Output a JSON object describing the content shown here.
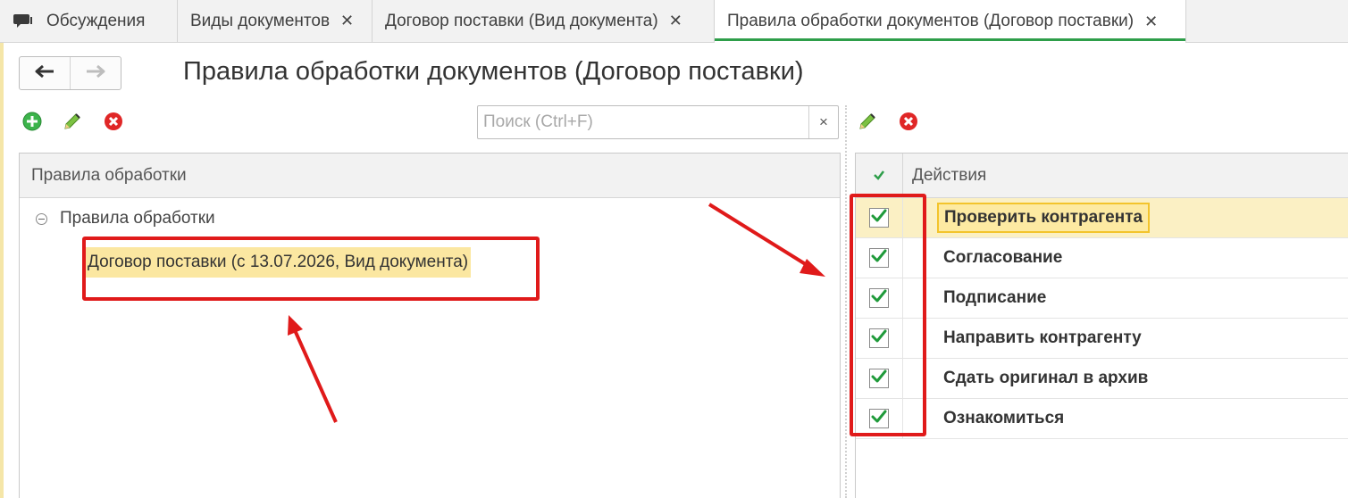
{
  "tabs": [
    {
      "label": "Обсуждения",
      "closable": false,
      "active": false
    },
    {
      "label": "Виды документов",
      "closable": true,
      "active": false
    },
    {
      "label": "Договор поставки (Вид документа)",
      "closable": true,
      "active": false
    },
    {
      "label": "Правила обработки документов (Договор поставки)",
      "closable": true,
      "active": true
    }
  ],
  "close_glyph": "✕",
  "nav": {
    "back_icon": "arrow-left-icon",
    "forward_icon": "arrow-right-icon"
  },
  "page": {
    "title": "Правила обработки документов (Договор поставки)"
  },
  "search": {
    "placeholder": "Поиск (Ctrl+F)",
    "value": "",
    "clear_glyph": "×"
  },
  "left_table": {
    "header": "Правила обработки",
    "root": "Правила обработки",
    "items": [
      "Договор поставки (с 13.07.2026, Вид документа)"
    ]
  },
  "right_table": {
    "header": "Действия",
    "rows": [
      {
        "label": "Проверить контрагента",
        "checked": true,
        "selected": true
      },
      {
        "label": "Согласование",
        "checked": true,
        "selected": false
      },
      {
        "label": "Подписание",
        "checked": true,
        "selected": false
      },
      {
        "label": "Направить контрагенту",
        "checked": true,
        "selected": false
      },
      {
        "label": "Сдать оригинал в архив",
        "checked": true,
        "selected": false
      },
      {
        "label": "Ознакомиться",
        "checked": true,
        "selected": false
      }
    ]
  },
  "colors": {
    "accent_green": "#2e9e4a",
    "annotation_red": "#e01a1a",
    "selection_yellow": "#fbe7a1"
  }
}
